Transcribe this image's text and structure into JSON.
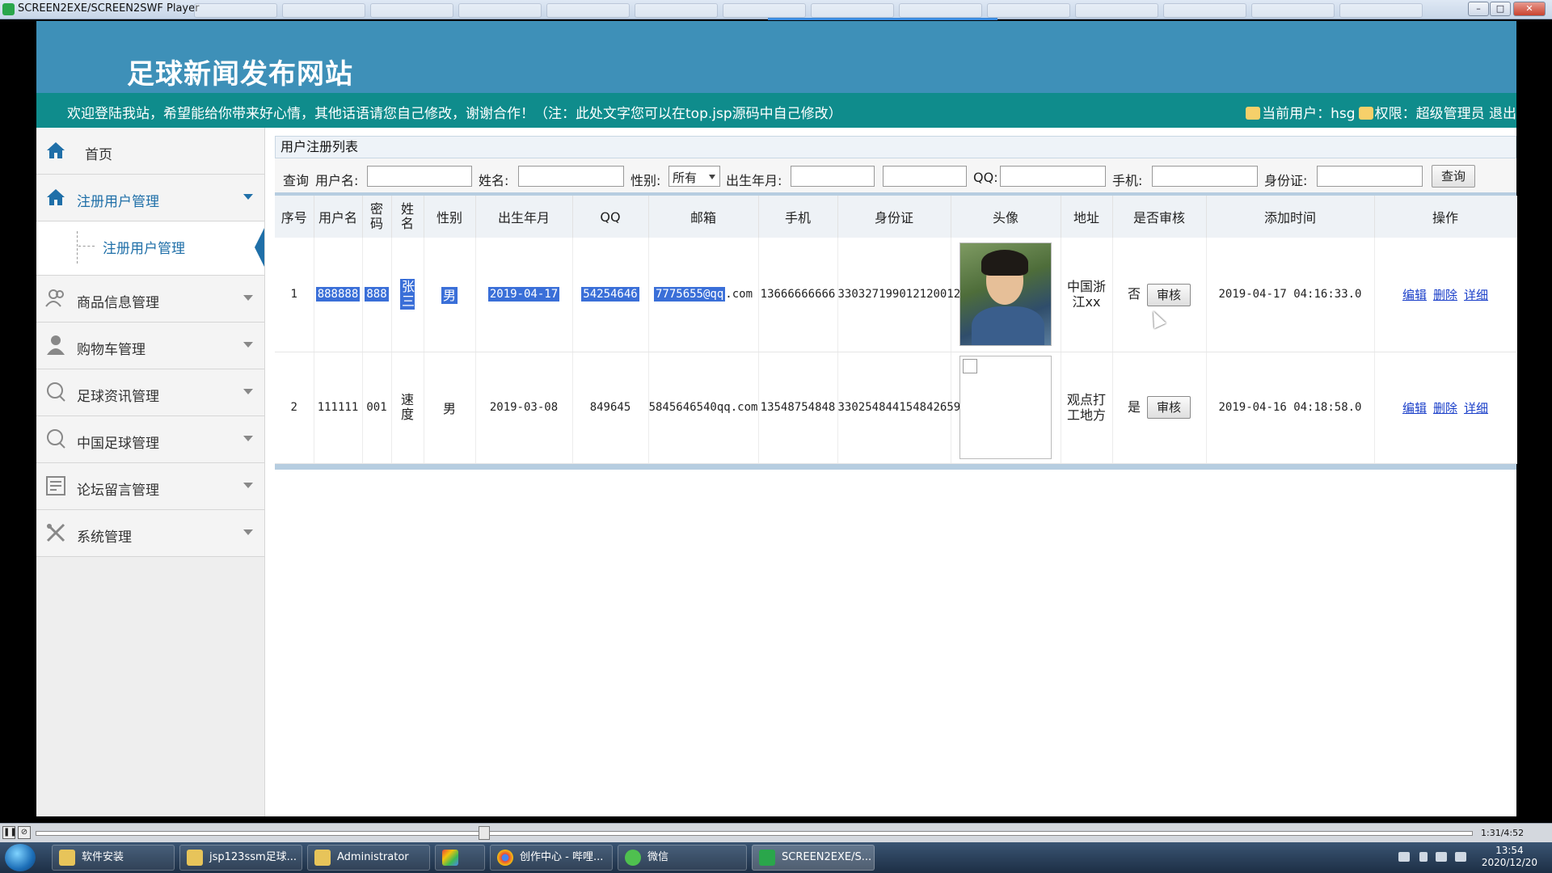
{
  "window": {
    "title": "SCREEN2EXE/SCREEN2SWF Player"
  },
  "site": {
    "title": "足球新闻发布网站",
    "notice": "欢迎登陆我站，希望能给你带来好心情，其他话语请您自己修改，谢谢合作！（注：此处文字您可以在top.jsp源码中自己修改）",
    "current_user": "当前用户：hsg",
    "permission": "权限：超级管理员 退出"
  },
  "sidebar": {
    "home": "首页",
    "items": [
      {
        "label": "注册用户管理",
        "icon": "home-icon",
        "active": true
      },
      {
        "label": "商品信息管理",
        "icon": "users-icon"
      },
      {
        "label": "购物车管理",
        "icon": "person-icon"
      },
      {
        "label": "足球资讯管理",
        "icon": "chat-icon"
      },
      {
        "label": "中国足球管理",
        "icon": "chat-icon"
      },
      {
        "label": "论坛留言管理",
        "icon": "forum-icon"
      },
      {
        "label": "系统管理",
        "icon": "tools-icon"
      }
    ],
    "subitem": "注册用户管理"
  },
  "main": {
    "breadcrumb": "用户注册列表",
    "search": {
      "query_label": "查询",
      "username_label": "用户名:",
      "name_label": "姓名:",
      "gender_label": "性别:",
      "gender_value": "所有",
      "birth_label": "出生年月:",
      "qq_label": "QQ:",
      "phone_label": "手机:",
      "idcard_label": "身份证:",
      "submit": "查询"
    },
    "columns": [
      "序号",
      "用户名",
      "密码",
      "姓名",
      "性别",
      "出生年月",
      "QQ",
      "邮箱",
      "手机",
      "身份证",
      "头像",
      "地址",
      "是否审核",
      "添加时间",
      "操作"
    ],
    "rows": [
      {
        "no": "1",
        "username": "888888",
        "password": "888",
        "name": "张三",
        "gender": "男",
        "birth": "2019-04-17",
        "qq": "54254646",
        "email_hl": "7775655@qq",
        "email_rest": ".com",
        "phone": "13666666666",
        "idcard": "330327199012120012",
        "address": "中国浙江xx",
        "audited": "否",
        "audit_btn": "审核",
        "added": "2019-04-17 04:16:33.0",
        "ops": [
          "编辑",
          "删除",
          "详细"
        ]
      },
      {
        "no": "2",
        "username": "111111",
        "password": "001",
        "name": "速度",
        "gender": "男",
        "birth": "2019-03-08",
        "qq": "849645",
        "email": "5845646540qq.com",
        "phone": "13548754848",
        "idcard": "330254844154842659",
        "address": "观点打工地方",
        "audited": "是",
        "audit_btn": "审核",
        "added": "2019-04-16 04:18:58.0",
        "ops": [
          "编辑",
          "删除",
          "详细"
        ]
      }
    ]
  },
  "player": {
    "time": "1:31/4:52"
  },
  "taskbar": {
    "tasks": [
      "软件安装",
      "jsp123ssm足球...",
      "Administrator",
      "",
      "创作中心 - 哔哩...",
      "微信",
      "SCREEN2EXE/S..."
    ],
    "time": "13:54",
    "date": "2020/12/20"
  }
}
